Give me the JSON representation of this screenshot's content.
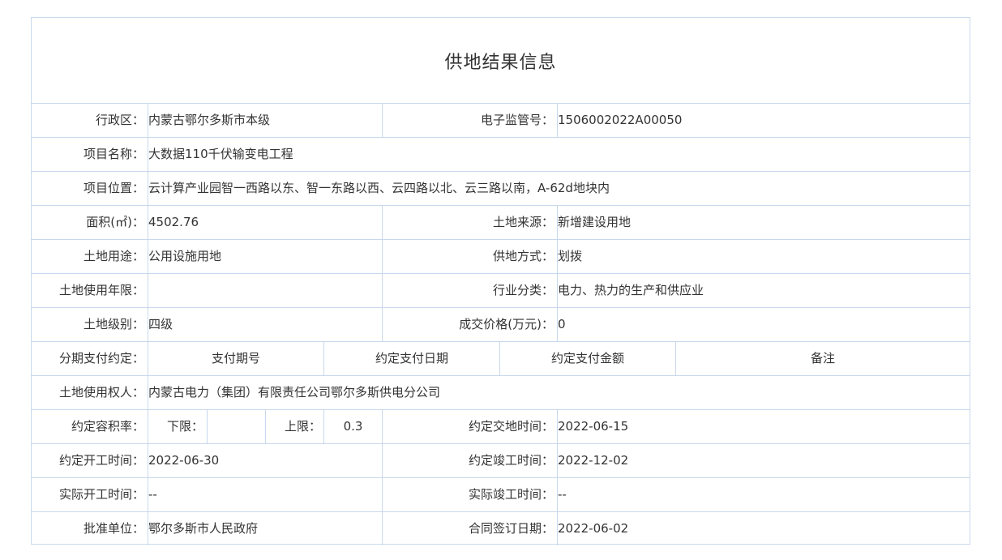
{
  "title": "供地结果信息",
  "rows": {
    "r1": {
      "label": "行政区：",
      "value": "内蒙古鄂尔多斯市本级",
      "label2": "电子监管号：",
      "value2": "1506002022A00050"
    },
    "r2": {
      "label": "项目名称：",
      "value": "大数据110千伏输变电工程"
    },
    "r3": {
      "label": "项目位置：",
      "value": "云计算产业园智一西路以东、智一东路以西、云四路以北、云三路以南，A-62d地块内"
    },
    "r4": {
      "label": "面积(㎡)：",
      "value": "4502.76",
      "label2": "土地来源：",
      "value2": "新增建设用地"
    },
    "r5": {
      "label": "土地用途：",
      "value": "公用设施用地",
      "label2": "供地方式：",
      "value2": "划拨"
    },
    "r6": {
      "label": "土地使用年限：",
      "value": "",
      "label2": "行业分类：",
      "value2": "电力、热力的生产和供应业"
    },
    "r7": {
      "label": "土地级别：",
      "value": "四级",
      "label2": "成交价格(万元)：",
      "value2": "0"
    },
    "r8": {
      "label": "分期支付约定：",
      "h1": "支付期号",
      "h2": "约定支付日期",
      "h3": "约定支付金额",
      "h4": "备注"
    },
    "r9": {
      "label": "土地使用权人：",
      "value": "内蒙古电力（集团）有限责任公司鄂尔多斯供电分公司"
    },
    "r10": {
      "label": "约定容积率：",
      "lower_label": "下限：",
      "lower_value": "",
      "upper_label": "上限：",
      "upper_value": "0.3",
      "label2": "约定交地时间：",
      "value2": "2022-06-15"
    },
    "r11": {
      "label": "约定开工时间：",
      "value": "2022-06-30",
      "label2": "约定竣工时间：",
      "value2": "2022-12-02"
    },
    "r12": {
      "label": "实际开工时间：",
      "value": "--",
      "label2": "实际竣工时间：",
      "value2": "--"
    },
    "r13": {
      "label": "批准单位：",
      "value": "鄂尔多斯市人民政府",
      "label2": "合同签订日期：",
      "value2": "2022-06-02"
    }
  }
}
